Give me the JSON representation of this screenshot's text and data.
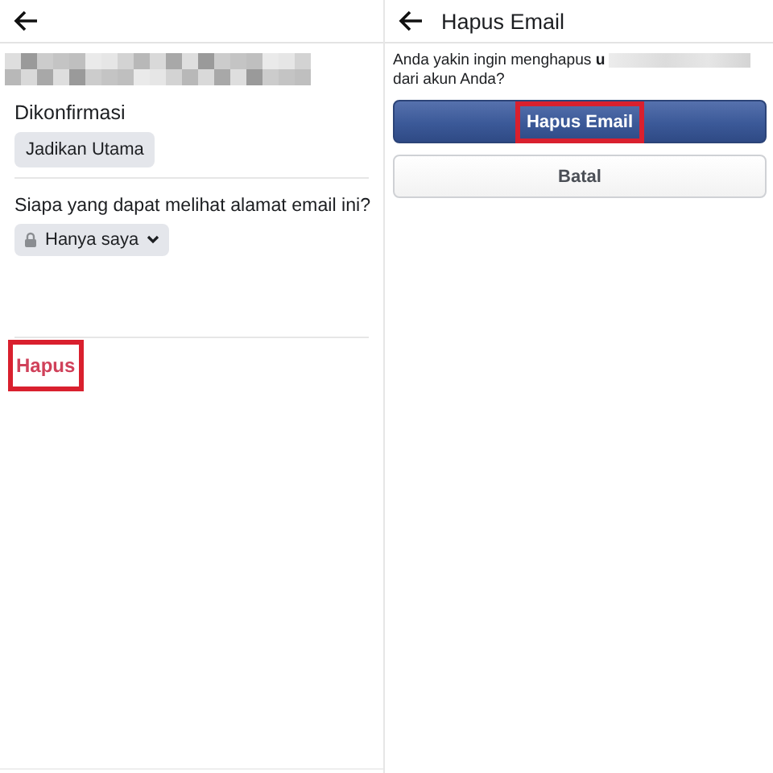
{
  "left_screen": {
    "status_label": "Dikonfirmasi",
    "make_primary_button": "Jadikan Utama",
    "visibility_question": "Siapa yang dapat melihat alamat email ini?",
    "visibility_dropdown": {
      "value": "Hanya saya"
    },
    "remove_link": {
      "label": "Hapus",
      "highlighted": true
    }
  },
  "right_screen": {
    "title": "Hapus Email",
    "message_start": "Anda yakin ingin menghapus **u**",
    "message_end": "dari akun Anda?",
    "buttons": [
      {
        "label": "Hapus Email",
        "kind": "primary",
        "highlighted": true
      },
      {
        "label": "Batal",
        "kind": "secondary",
        "highlighted": false
      }
    ]
  }
}
